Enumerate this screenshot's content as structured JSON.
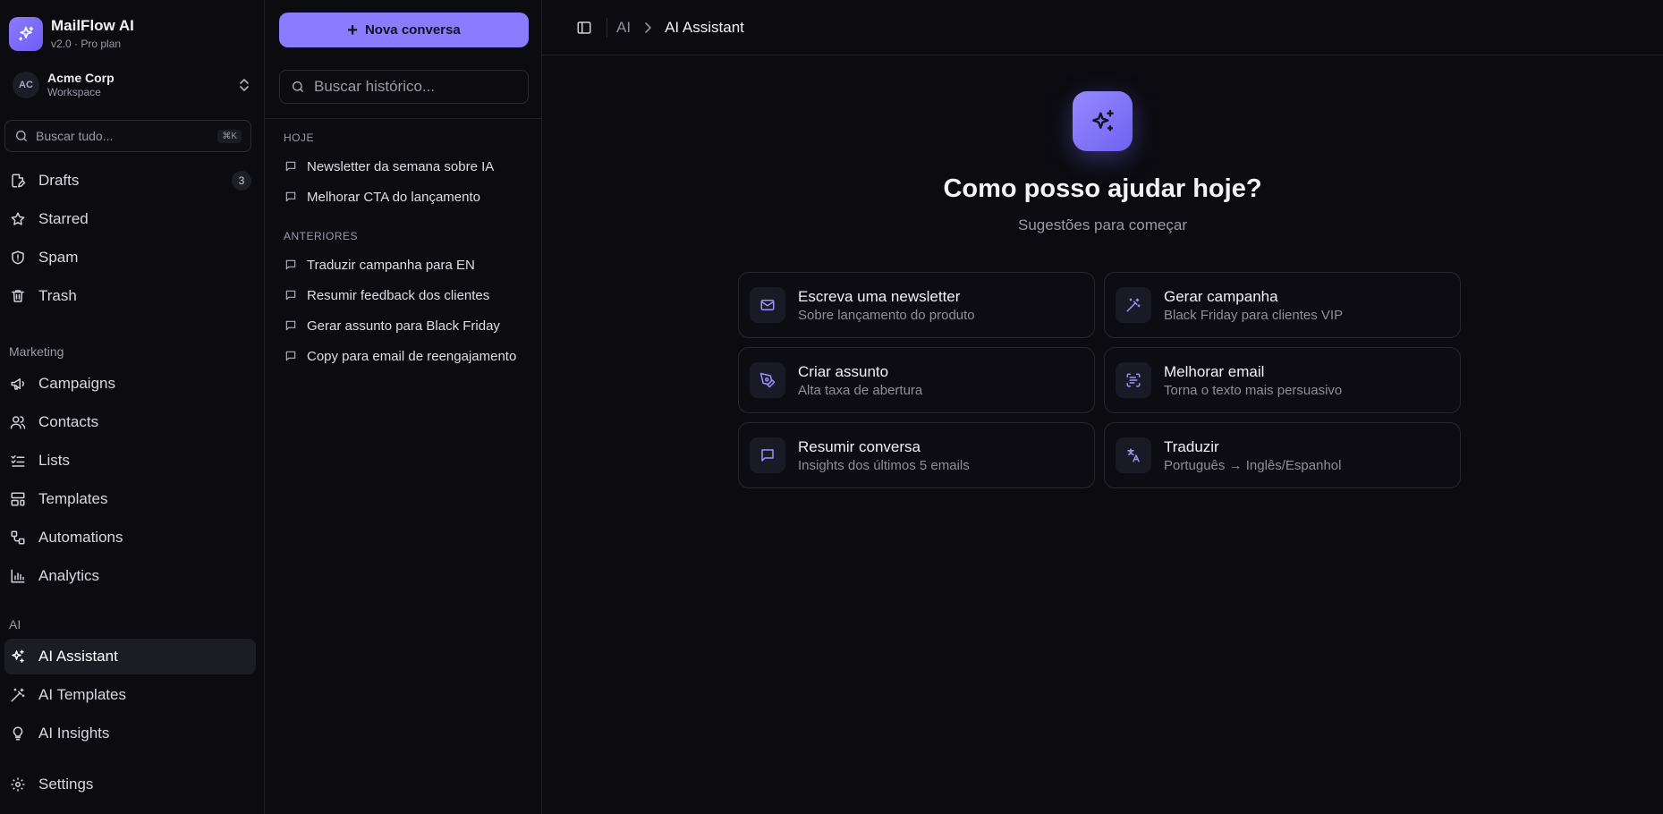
{
  "brand": {
    "name": "MailFlow AI",
    "subtitle": "v2.0 · Pro plan"
  },
  "workspace": {
    "initials": "AC",
    "name": "Acme Corp",
    "label": "Workspace"
  },
  "global_search": {
    "placeholder": "Buscar tudo...",
    "shortcut": "⌘K"
  },
  "nav_top": [
    {
      "label": "Drafts",
      "badge": "3",
      "icon": "draft-icon"
    },
    {
      "label": "Starred",
      "icon": "star-icon"
    },
    {
      "label": "Spam",
      "icon": "shield-alert-icon"
    },
    {
      "label": "Trash",
      "icon": "trash-icon"
    }
  ],
  "sections": {
    "marketing": "Marketing",
    "ai": "AI"
  },
  "nav_marketing": [
    {
      "label": "Campaigns",
      "icon": "megaphone-icon"
    },
    {
      "label": "Contacts",
      "icon": "users-icon"
    },
    {
      "label": "Lists",
      "icon": "list-checks-icon"
    },
    {
      "label": "Templates",
      "icon": "layout-template-icon"
    },
    {
      "label": "Automations",
      "icon": "workflow-icon"
    },
    {
      "label": "Analytics",
      "icon": "bar-chart-icon"
    }
  ],
  "nav_ai": [
    {
      "label": "AI Assistant",
      "icon": "sparkles-icon",
      "active": true
    },
    {
      "label": "AI Templates",
      "icon": "wand-icon"
    },
    {
      "label": "AI Insights",
      "icon": "lightbulb-icon"
    }
  ],
  "nav_bottom": {
    "label": "Settings",
    "icon": "gear-icon"
  },
  "history": {
    "new_chat_label": "Nova conversa",
    "search_placeholder": "Buscar histórico...",
    "groups": [
      {
        "label": "HOJE",
        "items": [
          "Newsletter da semana sobre IA",
          "Melhorar CTA do lançamento"
        ]
      },
      {
        "label": "ANTERIORES",
        "items": [
          "Traduzir campanha para EN",
          "Resumir feedback dos clientes",
          "Gerar assunto para Black Friday",
          "Copy para email de reengajamento"
        ]
      }
    ]
  },
  "breadcrumb": {
    "parent": "AI",
    "current": "AI Assistant"
  },
  "hero": {
    "title": "Como posso ajudar hoje?",
    "subtitle": "Sugestões para começar"
  },
  "suggestions": [
    {
      "title": "Escreva uma newsletter",
      "subtitle": "Sobre lançamento do produto",
      "icon": "mail-icon"
    },
    {
      "title": "Gerar campanha",
      "subtitle": "Black Friday para clientes VIP",
      "icon": "wand-icon"
    },
    {
      "title": "Criar assunto",
      "subtitle": "Alta taxa de abertura",
      "icon": "pen-tool-icon"
    },
    {
      "title": "Melhorar email",
      "subtitle": "Torna o texto mais persuasivo",
      "icon": "scan-text-icon"
    },
    {
      "title": "Resumir conversa",
      "subtitle": "Insights dos últimos 5 emails",
      "icon": "message-square-icon"
    },
    {
      "title": "Traduzir",
      "subtitle": "Português → Inglês/Espanhol",
      "icon": "languages-icon"
    }
  ],
  "colors": {
    "accent": "#8a7cff",
    "background": "#0b0b10",
    "border": "#262630",
    "muted_text": "#9a9aa8"
  }
}
